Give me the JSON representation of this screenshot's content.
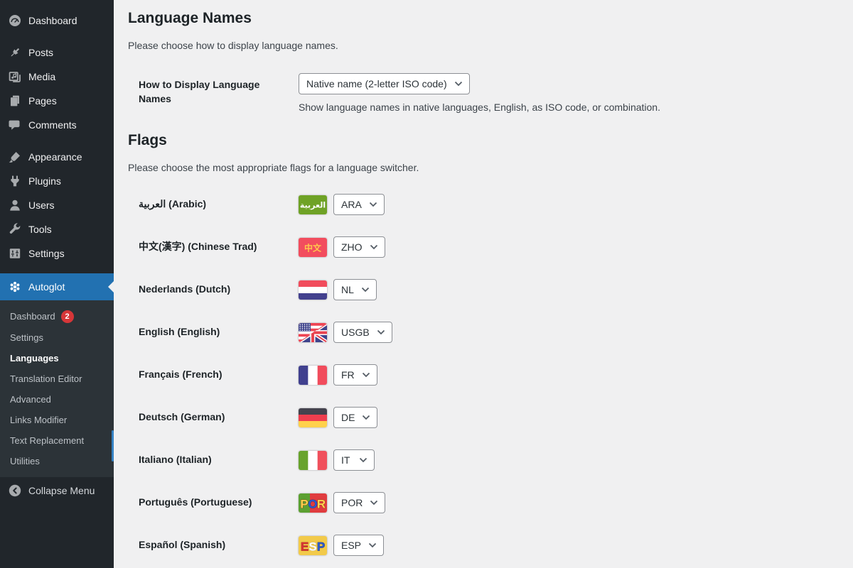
{
  "colors": {
    "accent_blue": "#2271b1",
    "badge_red": "#d63638",
    "sidebar_bg": "#21262b",
    "submenu_bg": "#2c3338",
    "content_bg": "#f0f0f1"
  },
  "sidebar": {
    "menu_groups": [
      {
        "items": [
          {
            "label": "Dashboard",
            "icon": "dashboard-icon"
          }
        ]
      },
      {
        "items": [
          {
            "label": "Posts",
            "icon": "pushpin-icon"
          },
          {
            "label": "Media",
            "icon": "media-icon"
          },
          {
            "label": "Pages",
            "icon": "pages-icon"
          },
          {
            "label": "Comments",
            "icon": "comment-icon"
          }
        ]
      },
      {
        "items": [
          {
            "label": "Appearance",
            "icon": "brush-icon"
          },
          {
            "label": "Plugins",
            "icon": "plug-icon"
          },
          {
            "label": "Users",
            "icon": "user-icon"
          },
          {
            "label": "Tools",
            "icon": "wrench-icon"
          },
          {
            "label": "Settings",
            "icon": "sliders-icon"
          }
        ]
      }
    ],
    "autoglot": {
      "label": "Autoglot",
      "icon": "autoglot-flower-icon"
    },
    "submenu": [
      {
        "label": "Dashboard",
        "badge": "2"
      },
      {
        "label": "Settings"
      },
      {
        "label": "Languages",
        "current": true
      },
      {
        "label": "Translation Editor"
      },
      {
        "label": "Advanced"
      },
      {
        "label": "Links Modifier"
      },
      {
        "label": "Text Replacement"
      },
      {
        "label": "Utilities"
      }
    ],
    "collapse": {
      "label": "Collapse Menu",
      "icon": "collapse-arrow-icon"
    }
  },
  "content": {
    "language_names": {
      "title": "Language Names",
      "intro": "Please choose how to display language names.",
      "field_label": "How to Display Language Names",
      "select_value": "Native name (2-letter ISO code)",
      "description": "Show language names in native languages, English, as ISO code, or combination."
    },
    "flags": {
      "title": "Flags",
      "intro": "Please choose the most appropriate flags for a language switcher.",
      "rows": [
        {
          "label": "العربية (Arabic)",
          "flag": "ara",
          "select_value": "ARA"
        },
        {
          "label": "中文(漢字) (Chinese Trad)",
          "flag": "zho",
          "select_value": "ZHO"
        },
        {
          "label": "Nederlands (Dutch)",
          "flag": "nl",
          "select_value": "NL"
        },
        {
          "label": "English (English)",
          "flag": "usgb",
          "select_value": "USGB"
        },
        {
          "label": "Français (French)",
          "flag": "fr",
          "select_value": "FR"
        },
        {
          "label": "Deutsch (German)",
          "flag": "de",
          "select_value": "DE"
        },
        {
          "label": "Italiano (Italian)",
          "flag": "it",
          "select_value": "IT"
        },
        {
          "label": "Português (Portuguese)",
          "flag": "por",
          "select_value": "POR"
        },
        {
          "label": "Español (Spanish)",
          "flag": "esp",
          "select_value": "ESP"
        }
      ]
    }
  }
}
